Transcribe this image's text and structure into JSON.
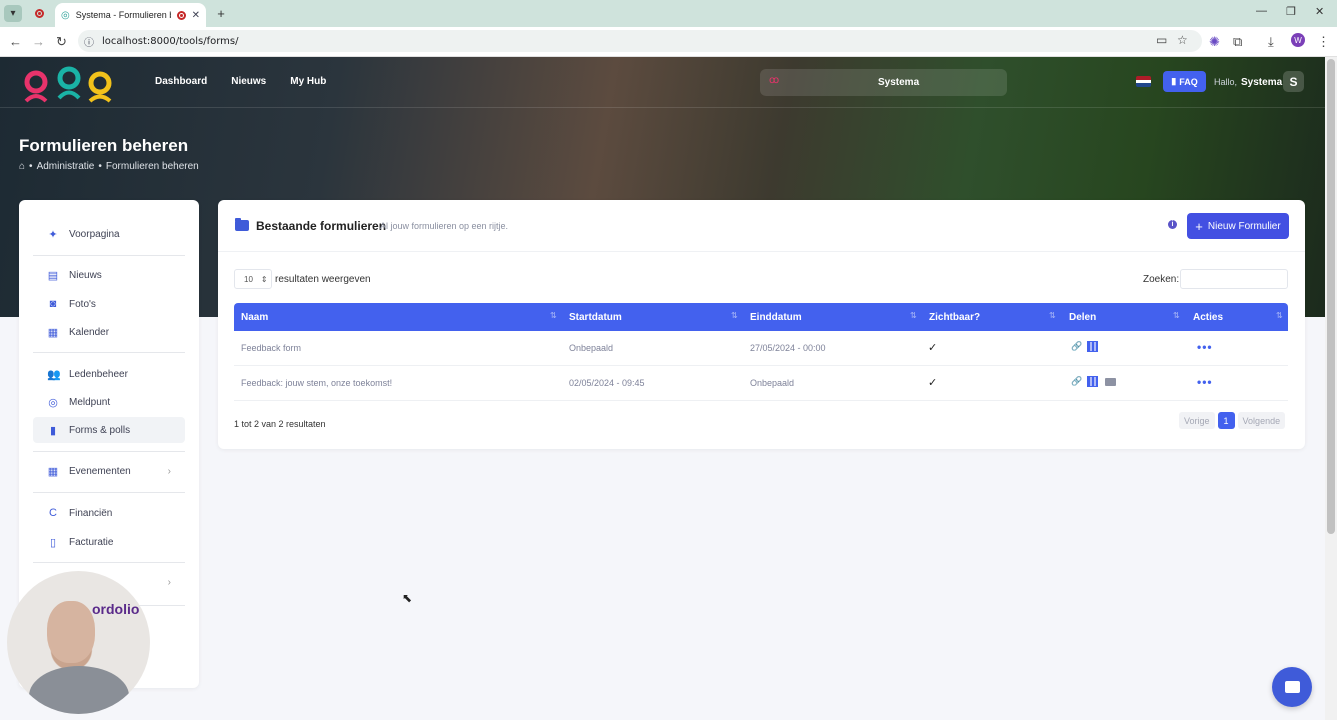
{
  "browser": {
    "tab_title": "Systema - Formulieren beheren",
    "url": "localhost:8000/tools/forms/",
    "profile_initial": "W"
  },
  "header": {
    "nav": [
      "Dashboard",
      "Nieuws",
      "My Hub"
    ],
    "org_name": "Systema",
    "faq_label": "FAQ",
    "hello_label": "Hallo,",
    "user_name": "Systema",
    "avatar_initial": "S",
    "colors": {
      "accent": "#4361ee",
      "faq": "#4361ee"
    }
  },
  "page": {
    "title": "Formulieren beheren",
    "breadcrumb": [
      "Administratie",
      "Formulieren beheren"
    ]
  },
  "sidebar": {
    "items": [
      {
        "label": "Voorpagina",
        "icon": "sparkle-icon"
      },
      {
        "label": "Nieuws",
        "icon": "newspaper-icon"
      },
      {
        "label": "Foto's",
        "icon": "camera-icon"
      },
      {
        "label": "Kalender",
        "icon": "calendar-icon"
      },
      {
        "label": "Ledenbeheer",
        "icon": "users-icon"
      },
      {
        "label": "Meldpunt",
        "icon": "bell-icon"
      },
      {
        "label": "Forms & polls",
        "icon": "clipboard-icon"
      },
      {
        "label": "Evenementen",
        "icon": "calendar-icon"
      },
      {
        "label": "Financiën",
        "icon": "currency-icon"
      },
      {
        "label": "Facturatie",
        "icon": "invoice-icon"
      }
    ]
  },
  "card": {
    "title": "Bestaande formulieren",
    "subtitle": "Al jouw formulieren op een rijtje.",
    "new_button": "Nieuw Formulier",
    "page_length": "10",
    "length_label": "resultaten weergeven",
    "search_label": "Zoeken:",
    "columns": [
      "Naam",
      "Startdatum",
      "Einddatum",
      "Zichtbaar?",
      "Delen",
      "Acties"
    ],
    "rows": [
      {
        "naam": "Feedback form",
        "start": "Onbepaald",
        "eind": "27/05/2024 - 00:00",
        "zichtbaar": "✓"
      },
      {
        "naam": "Feedback: jouw stem, onze toekomst!",
        "start": "02/05/2024 - 09:45",
        "eind": "Onbepaald",
        "zichtbaar": "✓"
      }
    ],
    "info": "1 tot 2 van 2 resultaten",
    "pager": {
      "prev": "Vorige",
      "current": "1",
      "next": "Volgende"
    }
  },
  "webcam_brand": "ordolio"
}
